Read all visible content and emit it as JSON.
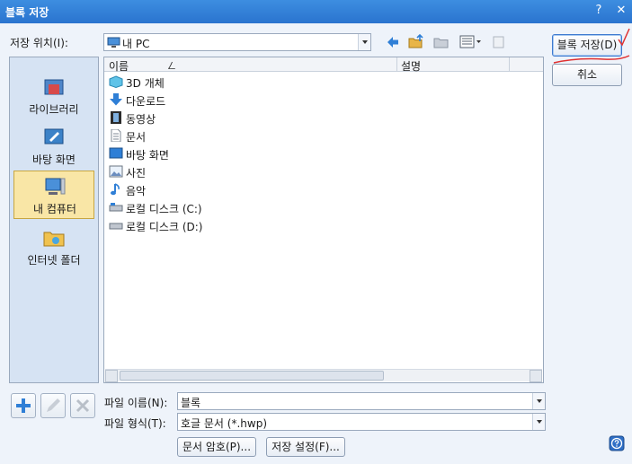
{
  "window": {
    "title": "블록 저장",
    "help_label": "?",
    "close_label": "✕"
  },
  "location": {
    "label": "저장 위치(I):",
    "value": "내 PC",
    "icon": "monitor-icon"
  },
  "places": [
    {
      "label": "라이브러리",
      "icon": "library-icon"
    },
    {
      "label": "바탕 화면",
      "icon": "desktop-icon"
    },
    {
      "label": "내 컴퓨터",
      "icon": "computer-icon",
      "selected": true
    },
    {
      "label": "인터넷 폴더",
      "icon": "internet-folder-icon"
    }
  ],
  "filelist": {
    "columns": [
      "이름",
      "설명"
    ],
    "sort_indicator": "ㄥ",
    "items": [
      {
        "name": "3D 개체",
        "icon": "cube-icon"
      },
      {
        "name": "다운로드",
        "icon": "download-icon"
      },
      {
        "name": "동영상",
        "icon": "film-icon"
      },
      {
        "name": "문서",
        "icon": "document-icon"
      },
      {
        "name": "바탕 화면",
        "icon": "desktop-icon"
      },
      {
        "name": "사진",
        "icon": "picture-icon"
      },
      {
        "name": "음악",
        "icon": "music-note-icon"
      },
      {
        "name": "로컬 디스크 (C:)",
        "icon": "drive-icon"
      },
      {
        "name": "로컬 디스크 (D:)",
        "icon": "drive-icon"
      }
    ]
  },
  "filename": {
    "label": "파일 이름(N):",
    "value": "블록"
  },
  "filetype": {
    "label": "파일 형식(T):",
    "value": "호글 문서 (*.hwp)"
  },
  "buttons": {
    "save": "블록 저장(D)",
    "cancel": "취소",
    "password": "문서 암호(P)...",
    "save_settings": "저장 설정(F)..."
  }
}
